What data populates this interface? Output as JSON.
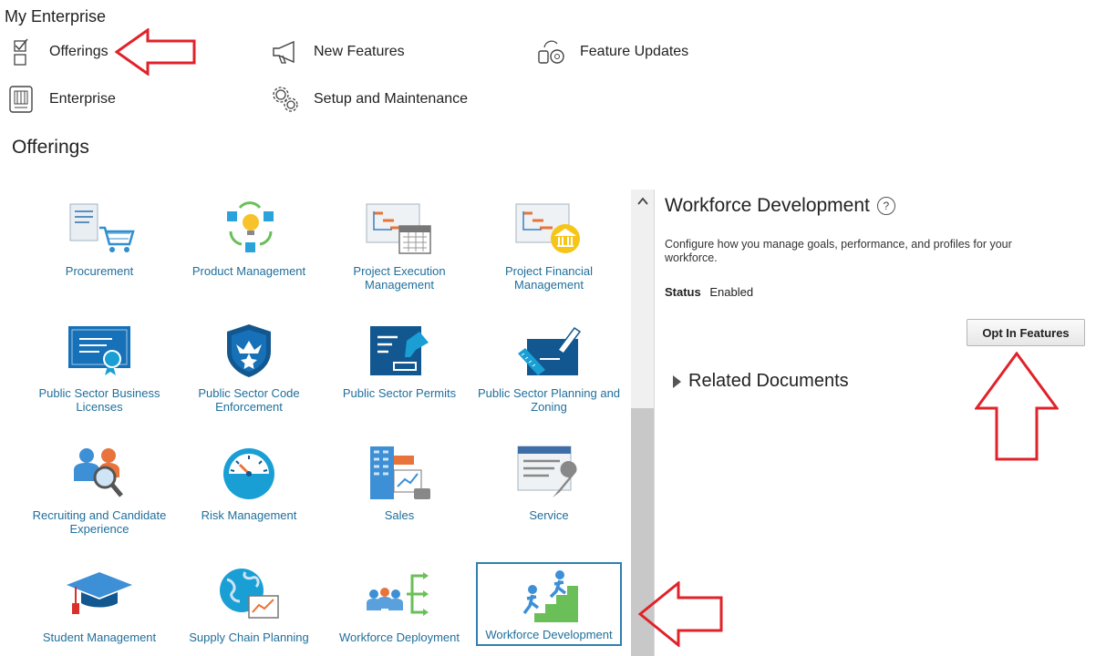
{
  "page_heading": "My Enterprise",
  "nav": [
    {
      "label": "Offerings",
      "icon": "checklist-icon"
    },
    {
      "label": "New Features",
      "icon": "megaphone-icon"
    },
    {
      "label": "Feature Updates",
      "icon": "feature-updates-icon"
    },
    {
      "label": "Enterprise",
      "icon": "building-icon"
    },
    {
      "label": "Setup and Maintenance",
      "icon": "gears-icon"
    }
  ],
  "offerings_title": "Offerings",
  "tiles": [
    {
      "label": "Procurement",
      "icon": "procurement-icon"
    },
    {
      "label": "Product Management",
      "icon": "product-management-icon"
    },
    {
      "label": "Project Execution Management",
      "icon": "project-execution-icon"
    },
    {
      "label": "Project Financial Management",
      "icon": "project-financial-icon"
    },
    {
      "label": "Public Sector Business Licenses",
      "icon": "certificate-icon"
    },
    {
      "label": "Public Sector Code Enforcement",
      "icon": "badge-icon"
    },
    {
      "label": "Public Sector Permits",
      "icon": "permit-stamp-icon"
    },
    {
      "label": "Public Sector Planning and Zoning",
      "icon": "planning-ruler-icon"
    },
    {
      "label": "Recruiting and Candidate Experience",
      "icon": "recruiting-icon"
    },
    {
      "label": "Risk Management",
      "icon": "gauge-icon"
    },
    {
      "label": "Sales",
      "icon": "sales-icon"
    },
    {
      "label": "Service",
      "icon": "service-icon"
    },
    {
      "label": "Student Management",
      "icon": "graduation-cap-icon"
    },
    {
      "label": "Supply Chain Planning",
      "icon": "globe-chart-icon"
    },
    {
      "label": "Workforce Deployment",
      "icon": "workforce-deployment-icon"
    },
    {
      "label": "Workforce Development",
      "icon": "stairs-climb-icon"
    }
  ],
  "detail": {
    "title": "Workforce Development",
    "help_glyph": "?",
    "description": "Configure how you manage goals, performance, and profiles for your workforce.",
    "status_label": "Status",
    "status_value": "Enabled",
    "opt_in_button": "Opt In Features",
    "related_documents": "Related Documents"
  },
  "colors": {
    "tile_text": "#1f6f9c",
    "annotation_arrow": "#e0222a",
    "selected_border": "#2f7fb0"
  }
}
